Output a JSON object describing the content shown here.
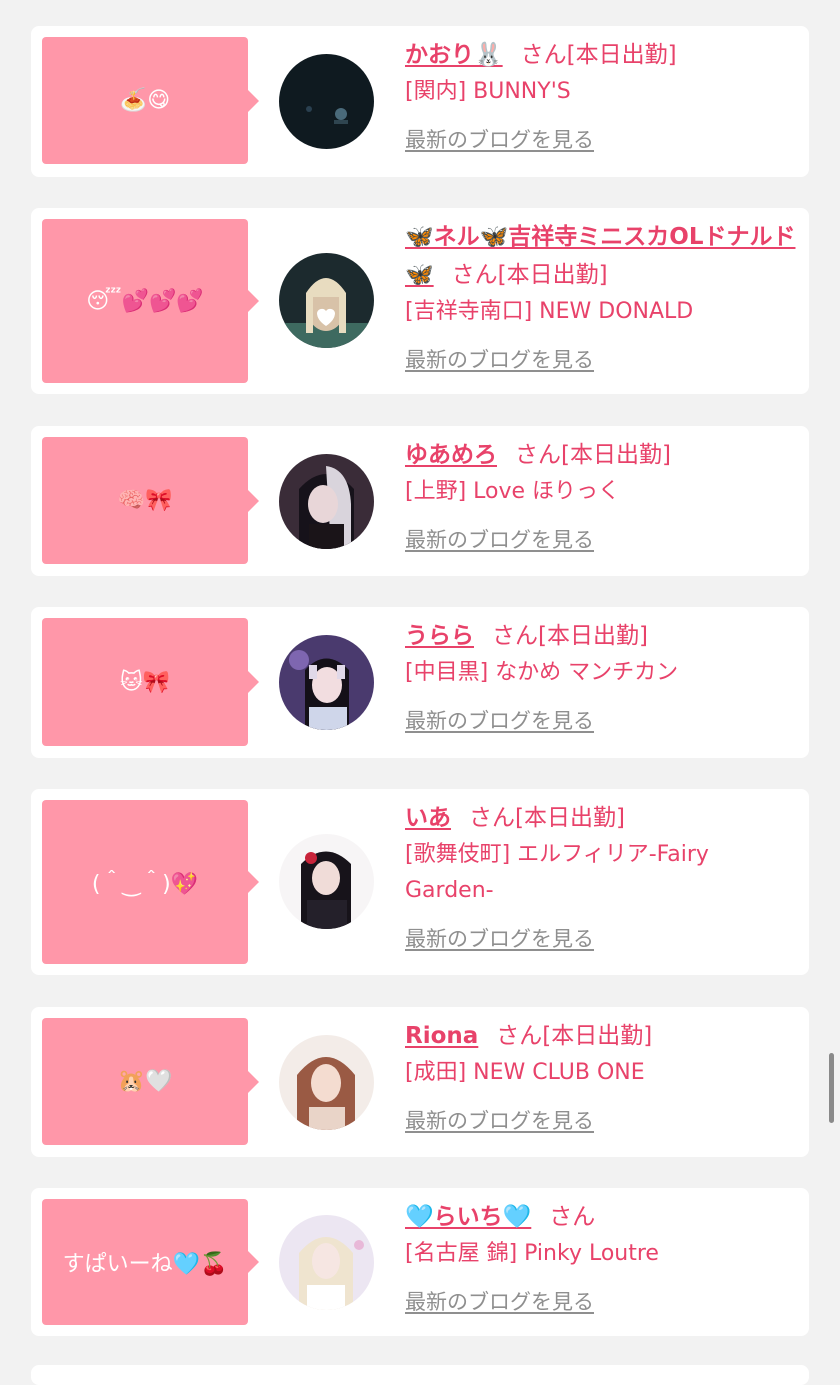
{
  "entries": [
    {
      "comment": "🍝😋",
      "name": "かおり🐰",
      "status": "さん[本日出勤]",
      "shop": "[関内] BUNNY'S",
      "blog_link": "最新のブログを見る"
    },
    {
      "comment": "😴💕💕💕",
      "name": "🦋ネル🦋吉祥寺ミニスカOLドナルド🦋",
      "status": "さん[本日出勤]",
      "shop": "[吉祥寺南口] NEW DONALD",
      "blog_link": "最新のブログを見る"
    },
    {
      "comment": "🧠🎀",
      "name": "ゆあめろ",
      "status": "さん[本日出勤]",
      "shop": "[上野] Love ほりっく",
      "blog_link": "最新のブログを見る"
    },
    {
      "comment": "🐱🎀",
      "name": "うらら",
      "status": "さん[本日出勤]",
      "shop": "[中目黒] なかめ マンチカン",
      "blog_link": "最新のブログを見る"
    },
    {
      "comment": "(＾‿＾)💖",
      "name": "いあ",
      "status": "さん[本日出勤]",
      "shop": "[歌舞伎町] エルフィリア-Fairy Garden-",
      "blog_link": "最新のブログを見る"
    },
    {
      "comment": "🐹🤍",
      "name": "Riona",
      "status": "さん[本日出勤]",
      "shop": "[成田] NEW CLUB ONE",
      "blog_link": "最新のブログを見る"
    },
    {
      "comment": "すぱいーね🩵🍒",
      "name": "🩵らいち🩵",
      "status": "さん",
      "shop": "[名古屋 錦] Pinky Loutre",
      "blog_link": "最新のブログを見る"
    }
  ]
}
